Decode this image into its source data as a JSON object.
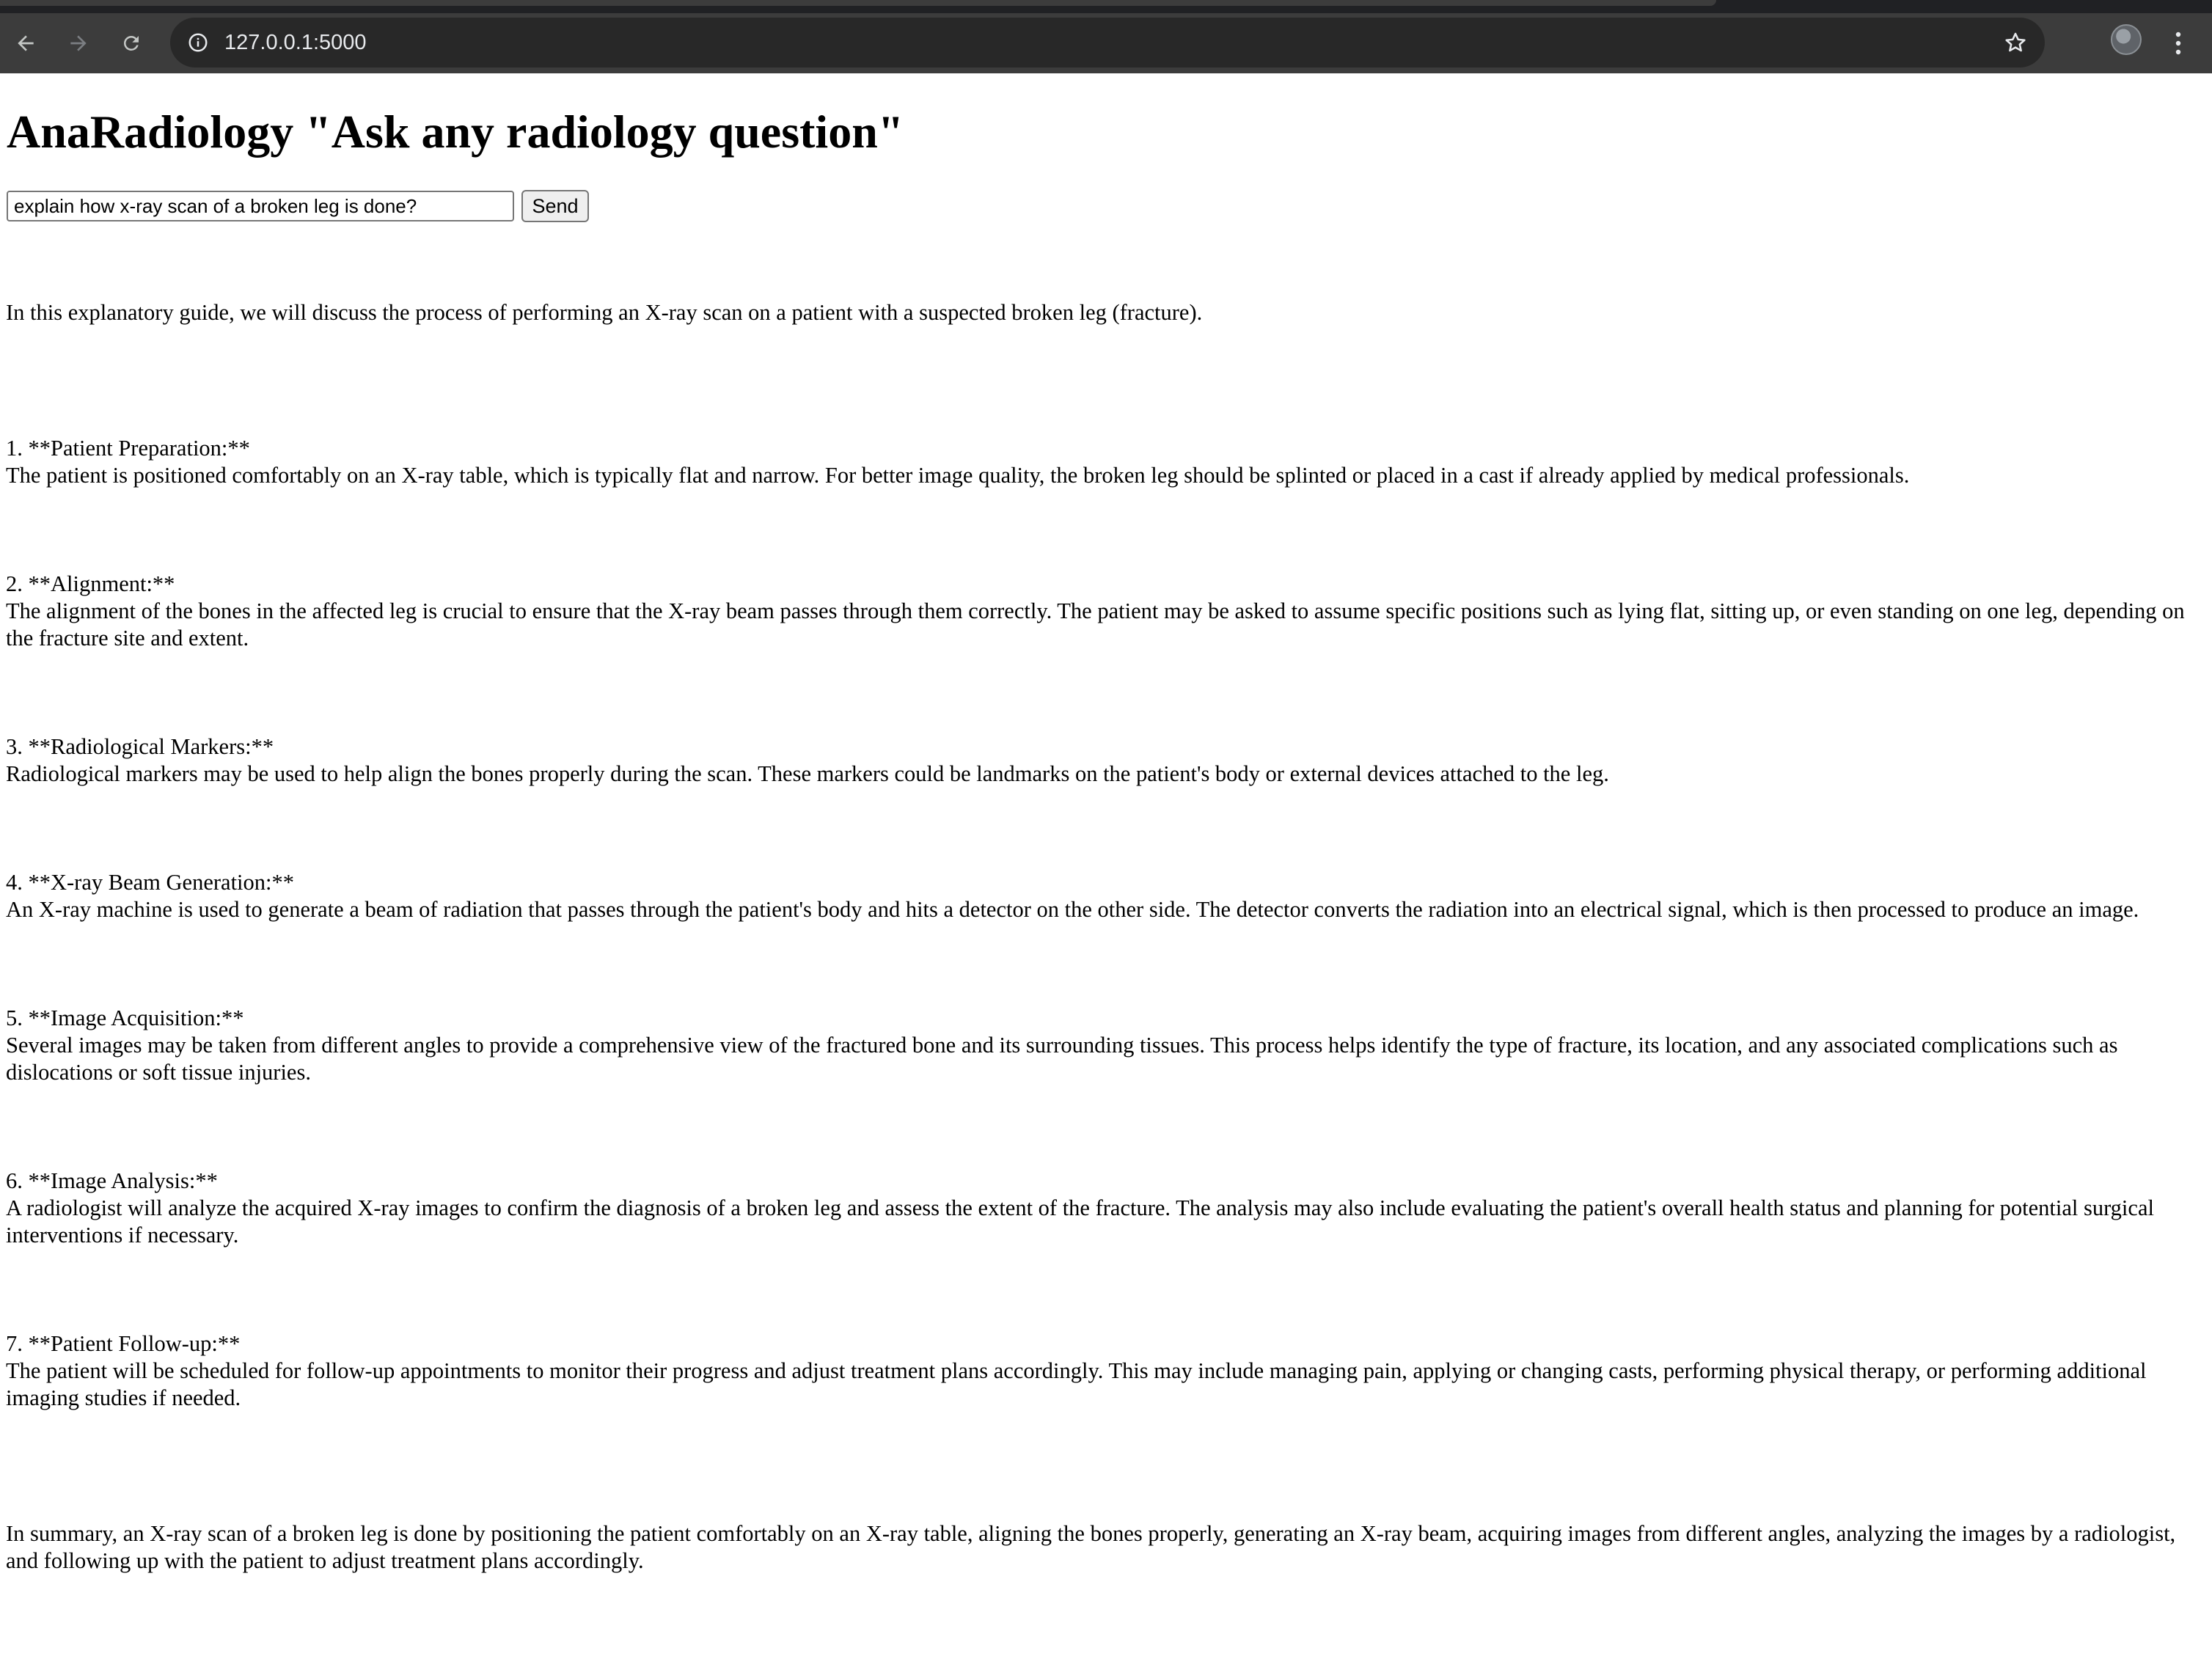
{
  "browser": {
    "url": "127.0.0.1:5000"
  },
  "page": {
    "title": "AnaRadiology \"Ask any radiology question\"",
    "input_value": "explain how x-ray scan of a broken leg is done?",
    "send_label": "Send"
  },
  "answer": {
    "intro": "In this explanatory guide, we will discuss the process of performing an X-ray scan on a patient with a suspected broken leg (fracture).",
    "steps": [
      {
        "heading": "1. **Patient Preparation:**",
        "body": "The patient is positioned comfortably on an X-ray table, which is typically flat and narrow. For better image quality, the broken leg should be splinted or placed in a cast if already applied by medical professionals."
      },
      {
        "heading": "2. **Alignment:**",
        "body": "The alignment of the bones in the affected leg is crucial to ensure that the X-ray beam passes through them correctly. The patient may be asked to assume specific positions such as lying flat, sitting up, or even standing on one leg, depending on the fracture site and extent."
      },
      {
        "heading": "3. **Radiological Markers:**",
        "body": "Radiological markers may be used to help align the bones properly during the scan. These markers could be landmarks on the patient's body or external devices attached to the leg."
      },
      {
        "heading": "4. **X-ray Beam Generation:**",
        "body": "An X-ray machine is used to generate a beam of radiation that passes through the patient's body and hits a detector on the other side. The detector converts the radiation into an electrical signal, which is then processed to produce an image."
      },
      {
        "heading": "5. **Image Acquisition:**",
        "body": "Several images may be taken from different angles to provide a comprehensive view of the fractured bone and its surrounding tissues. This process helps identify the type of fracture, its location, and any associated complications such as dislocations or soft tissue injuries."
      },
      {
        "heading": "6. **Image Analysis:**",
        "body": "A radiologist will analyze the acquired X-ray images to confirm the diagnosis of a broken leg and assess the extent of the fracture. The analysis may also include evaluating the patient's overall health status and planning for potential surgical interventions if necessary."
      },
      {
        "heading": "7. **Patient Follow-up:**",
        "body": "The patient will be scheduled for follow-up appointments to monitor their progress and adjust treatment plans accordingly. This may include managing pain, applying or changing casts, performing physical therapy, or performing additional imaging studies if needed."
      }
    ],
    "summary": "In summary, an X-ray scan of a broken leg is done by positioning the patient comfortably on an X-ray table, aligning the bones properly, generating an X-ray beam, acquiring images from different angles, analyzing the images by a radiologist, and following up with the patient to adjust treatment plans accordingly."
  },
  "icons": {
    "back": "arrow-left",
    "forward": "arrow-right",
    "reload": "reload",
    "site_info": "info-circle",
    "bookmark": "star-outline",
    "menu": "vertical-dots"
  }
}
